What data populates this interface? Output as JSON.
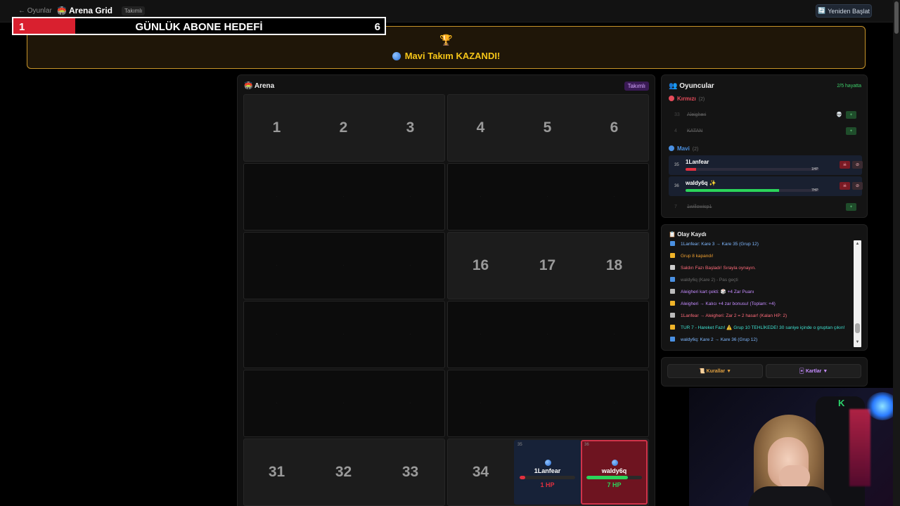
{
  "topbar": {
    "back_label": "← Oyunlar",
    "app_icon": "🏟️",
    "title": "Arena Grid",
    "mode_badge": "Takımlı",
    "restart_label": "Yeniden Başlat",
    "restart_icon": "🔄"
  },
  "goal": {
    "current": "1",
    "title": "GÜNLÜK ABONE HEDEFİ",
    "target": "6",
    "progress_fraction": 0.1667,
    "fill_color": "#d9202f"
  },
  "winner": {
    "trophy": "🏆",
    "text": "Mavi Takım KAZANDI!"
  },
  "arena": {
    "icon": "🏟️",
    "title": "Arena",
    "badge": "Takımlı",
    "rows": [
      [
        "1",
        "2",
        "3",
        "4",
        "5",
        "6"
      ],
      [
        "·",
        "·",
        "·",
        "·",
        "·",
        "·"
      ],
      [
        "·",
        "·",
        "·",
        "16",
        "17",
        "18"
      ],
      [
        "·",
        "·",
        "·",
        "·",
        "·",
        "·"
      ],
      [
        "·",
        "·",
        "·",
        "·",
        "·",
        "·"
      ],
      [
        "31",
        "32",
        "33",
        "34",
        "",
        ""
      ]
    ],
    "player_cells": [
      {
        "index": "35",
        "name": "1Lanfear",
        "hp": "1 HP",
        "hp_fraction": 0.1,
        "bar_color": "#e0303f",
        "bg": "#172238",
        "border": "#172238"
      },
      {
        "index": "36",
        "name": "waldy6q",
        "hp": "7 HP",
        "hp_fraction": 0.75,
        "bar_color": "#2bd45a",
        "bg": "#6e1420",
        "border": "#d0334a"
      }
    ]
  },
  "players": {
    "icon": "👥",
    "title": "Oyuncular",
    "alive_count": "2/5 hayatta",
    "red_team": {
      "label": "Kırmızı",
      "count": "(2)",
      "members": [
        {
          "index": "33",
          "name": "Aleigheri",
          "extra": "💀"
        },
        {
          "index": "4",
          "name": "KATAN",
          "extra": ""
        }
      ]
    },
    "blue_team": {
      "label": "Mavi",
      "count": "(2)",
      "members": [
        {
          "index": "35",
          "name": "1Lanfear",
          "hp": "1HP",
          "hp_fraction": 0.08,
          "bar_color": "#e0303f",
          "badge": ""
        },
        {
          "index": "36",
          "name": "waldy6q",
          "hp": "7HP",
          "hp_fraction": 0.7,
          "bar_color": "#2bd45a",
          "badge": "✨"
        }
      ],
      "eliminated": {
        "index": "7",
        "name": "1willowisp1"
      }
    }
  },
  "log": {
    "icon": "📋",
    "title": "Olay Kaydı",
    "entries": [
      {
        "icon_color": "#4a90e2",
        "text": "1Lanfear: Kare 3 → Kare 35 (Grup 12)",
        "color": "#7fb8ff"
      },
      {
        "icon_color": "#f0b429",
        "text": "Grup 8 kapandı!",
        "color": "#f0a030"
      },
      {
        "icon_color": "#cccccc",
        "text": "Saldırı Fazı Başladı! Sırayla oynayın.",
        "color": "#ff6b7a"
      },
      {
        "icon_color": "#4a90e2",
        "text": "waldy6q (Kare 2) - Pas geçti",
        "color": "#6a6a6a"
      },
      {
        "icon_color": "#bbbbbb",
        "text": "Aleigheri kart çekti: 🎲 +4 Zar Puanı",
        "color": "#c58cff"
      },
      {
        "icon_color": "#f0b429",
        "text": "Aleigheri → Kalıcı +4 zar bonusu! (Toplam: +4)",
        "color": "#c58cff"
      },
      {
        "icon_color": "#bbbbbb",
        "text": "1Lanfear → Aleigheri: Zar 2 = 2 hasar! (Kalan HP: 2)",
        "color": "#ff6b7a"
      },
      {
        "icon_color": "#f0b429",
        "text": "TUR 7 - Hareket Fazı! ⚠️ Grup 10 TEHLİKEDE! 30 saniye içinde o gruptan çıkın!",
        "color": "#3ee0d0"
      },
      {
        "icon_color": "#4a90e2",
        "text": "waldy6q: Kare 2 → Kare 36 (Grup 12)",
        "color": "#7fb8ff"
      }
    ]
  },
  "buttons": {
    "rules_icon": "📜",
    "rules_label": "Kurallar ▼",
    "cards_icon": "🃏",
    "cards_label": "Kartlar ▼"
  },
  "colors": {
    "accent_gold": "#c79429",
    "red_team": "#e54b5a",
    "blue_team": "#4a90e2",
    "alive_green": "#3ecf6a"
  }
}
